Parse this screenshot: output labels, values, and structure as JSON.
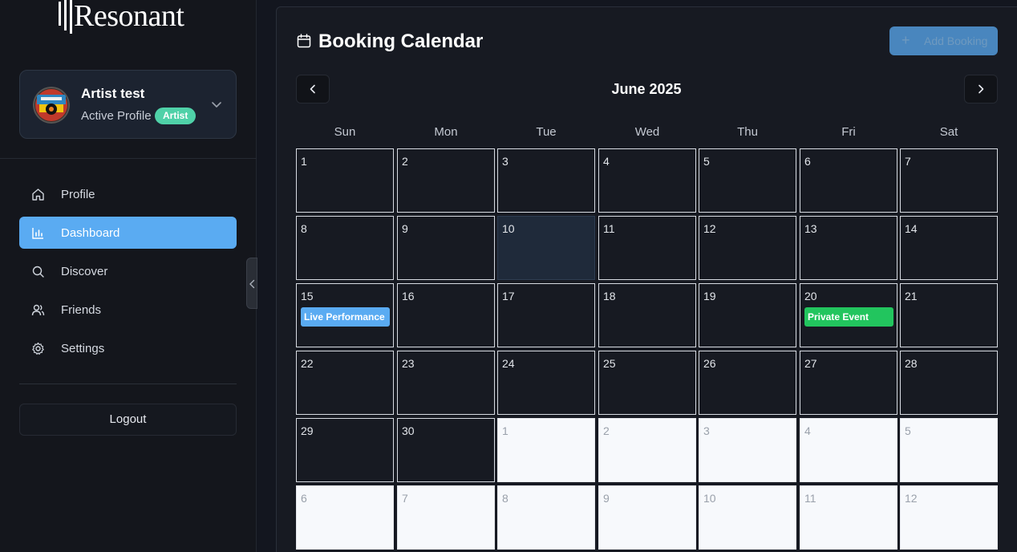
{
  "app": {
    "logo_text": "Resonant"
  },
  "profile": {
    "name": "Artist test",
    "status": "Active Profile",
    "badge": "Artist"
  },
  "nav": [
    {
      "label": "Profile",
      "icon": "home-icon",
      "active": false
    },
    {
      "label": "Dashboard",
      "icon": "bar-chart-icon",
      "active": true
    },
    {
      "label": "Discover",
      "icon": "search-icon",
      "active": false
    },
    {
      "label": "Friends",
      "icon": "users-icon",
      "active": false
    },
    {
      "label": "Settings",
      "icon": "gear-icon",
      "active": false
    }
  ],
  "logout_label": "Logout",
  "calendar": {
    "title": "Booking Calendar",
    "add_label": "Add Booking",
    "add_icon": "+",
    "month": "June 2025",
    "weekdays": [
      "Sun",
      "Mon",
      "Tue",
      "Wed",
      "Thu",
      "Fri",
      "Sat"
    ],
    "weeks": [
      [
        {
          "d": "1"
        },
        {
          "d": "2"
        },
        {
          "d": "3"
        },
        {
          "d": "4"
        },
        {
          "d": "5"
        },
        {
          "d": "6"
        },
        {
          "d": "7"
        }
      ],
      [
        {
          "d": "8"
        },
        {
          "d": "9"
        },
        {
          "d": "10",
          "today": true
        },
        {
          "d": "11"
        },
        {
          "d": "12"
        },
        {
          "d": "13"
        },
        {
          "d": "14"
        }
      ],
      [
        {
          "d": "15",
          "event": {
            "label": "Live Performance",
            "color": "#5aabf2"
          }
        },
        {
          "d": "16"
        },
        {
          "d": "17"
        },
        {
          "d": "18"
        },
        {
          "d": "19"
        },
        {
          "d": "20",
          "event": {
            "label": "Private Event",
            "color": "#22c55e"
          }
        },
        {
          "d": "21"
        }
      ],
      [
        {
          "d": "22"
        },
        {
          "d": "23"
        },
        {
          "d": "24"
        },
        {
          "d": "25"
        },
        {
          "d": "26"
        },
        {
          "d": "27"
        },
        {
          "d": "28"
        }
      ],
      [
        {
          "d": "29"
        },
        {
          "d": "30"
        },
        {
          "d": "1",
          "other": true
        },
        {
          "d": "2",
          "other": true
        },
        {
          "d": "3",
          "other": true
        },
        {
          "d": "4",
          "other": true
        },
        {
          "d": "5",
          "other": true
        }
      ],
      [
        {
          "d": "6",
          "other": true
        },
        {
          "d": "7",
          "other": true
        },
        {
          "d": "8",
          "other": true
        },
        {
          "d": "9",
          "other": true
        },
        {
          "d": "10",
          "other": true
        },
        {
          "d": "11",
          "other": true
        },
        {
          "d": "12",
          "other": true
        }
      ]
    ]
  },
  "colors": {
    "accent": "#5aabf2",
    "badge": "#4fd1a8",
    "private_event": "#22c55e"
  }
}
